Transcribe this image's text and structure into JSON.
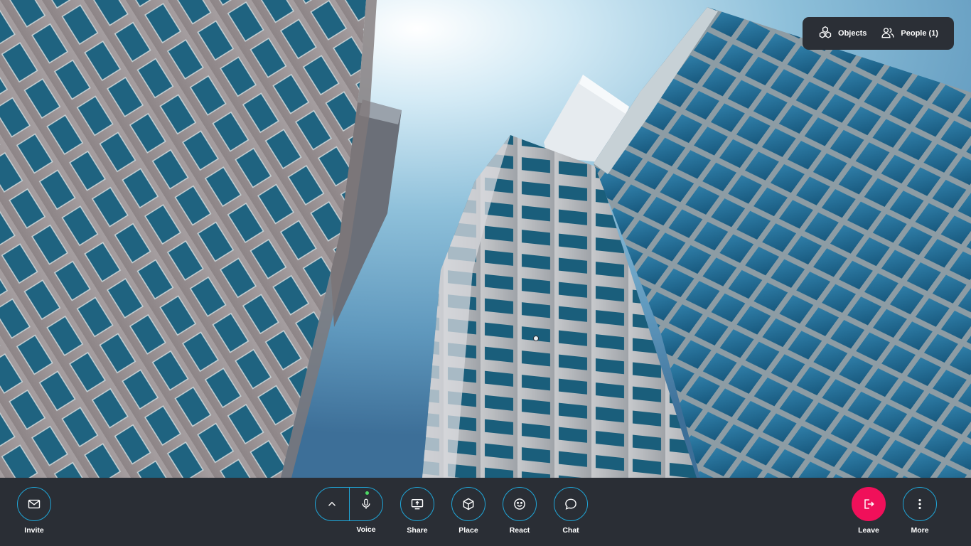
{
  "scene": {
    "description_icon": "city-skyscrapers-3d-view"
  },
  "top_panel": {
    "objects_label": "Objects",
    "objects_icon": "cubes-icon",
    "people_label": "People (1)",
    "people_icon": "people-icon"
  },
  "toolbar": {
    "invite_label": "Invite",
    "voice_label": "Voice",
    "share_label": "Share",
    "place_label": "Place",
    "react_label": "React",
    "chat_label": "Chat",
    "leave_label": "Leave",
    "more_label": "More",
    "mic_status_color": "#4cd964"
  },
  "colors": {
    "toolbar_bg": "#2a2e35",
    "accent": "#1fa6d8",
    "leave": "#f0105a"
  }
}
